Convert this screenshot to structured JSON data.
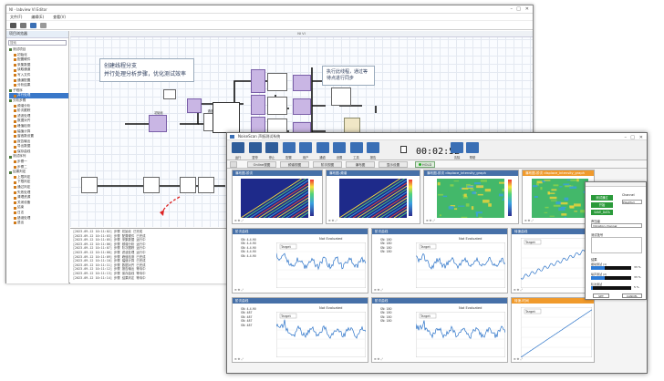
{
  "back_window": {
    "title": "NI - labview VI Editor",
    "menu": [
      "文件(F)",
      "编辑(E)",
      "查看(V)"
    ],
    "left_panel": {
      "header": "项目浏览器",
      "search_placeholder": "搜索",
      "tree": [
        {
          "label": "测试项目",
          "level": 0,
          "icon": "folder"
        },
        {
          "label": "初始化",
          "level": 1,
          "icon": "vi"
        },
        {
          "label": "配置硬件",
          "level": 1,
          "icon": "vi"
        },
        {
          "label": "采集数据",
          "level": 1,
          "icon": "vi"
        },
        {
          "label": "读取通道",
          "level": 1,
          "icon": "vi"
        },
        {
          "label": "写入文件",
          "level": 1,
          "icon": "vi"
        },
        {
          "label": "通道配置",
          "level": 1,
          "icon": "vi"
        },
        {
          "label": "分析结果",
          "level": 1,
          "icon": "vi"
        },
        {
          "label": "子程序",
          "level": 0,
          "icon": "folder"
        },
        {
          "label": "并行处理",
          "level": 1,
          "icon": "vi",
          "selected": true
        },
        {
          "label": "分析步骤",
          "level": 0,
          "icon": "folder"
        },
        {
          "label": "频谱分析",
          "level": 1,
          "icon": "vi"
        },
        {
          "label": "阶次跟踪",
          "level": 1,
          "icon": "vi"
        },
        {
          "label": "滤波处理",
          "level": 1,
          "icon": "vi"
        },
        {
          "label": "数据对齐",
          "level": 1,
          "icon": "vi"
        },
        {
          "label": "峰值检测",
          "level": 1,
          "icon": "vi"
        },
        {
          "label": "幅值计算",
          "level": 1,
          "icon": "vi"
        },
        {
          "label": "窗函数设置",
          "level": 1,
          "icon": "vi"
        },
        {
          "label": "报告输出",
          "level": 1,
          "icon": "vi"
        },
        {
          "label": "导出数据",
          "level": 1,
          "icon": "vi"
        },
        {
          "label": "保存曲线",
          "level": 1,
          "icon": "vi"
        },
        {
          "label": "测试序列",
          "level": 0,
          "icon": "folder"
        },
        {
          "label": "步骤一",
          "level": 1,
          "icon": "vi"
        },
        {
          "label": "步骤二",
          "level": 1,
          "icon": "vi"
        },
        {
          "label": "结果判定",
          "level": 0,
          "icon": "folder"
        },
        {
          "label": "上限判定",
          "level": 1,
          "icon": "vi"
        },
        {
          "label": "下限判定",
          "level": 1,
          "icon": "vi"
        },
        {
          "label": "通过判定",
          "level": 1,
          "icon": "vi"
        },
        {
          "label": "失败处理",
          "level": 1,
          "icon": "vi"
        },
        {
          "label": "清理资源",
          "level": 1,
          "icon": "vi"
        },
        {
          "label": "关闭设备",
          "level": 1,
          "icon": "vi"
        },
        {
          "label": "结束",
          "level": 1,
          "icon": "vi"
        },
        {
          "label": "日志",
          "level": 1,
          "icon": "vi"
        },
        {
          "label": "错误处理",
          "level": 1,
          "icon": "vi"
        },
        {
          "label": "退出",
          "level": 1,
          "icon": "vi"
        }
      ]
    },
    "canvas_tab": "NI VI",
    "note_left": [
      "创建线程分支",
      "并行处理分析步骤，优化测试效率"
    ],
    "note_right": [
      "执行此线程，通过等",
      "待点进行同步"
    ],
    "log_lines": [
      "[2023-09-12 10:11:02] 步骤 初始化 已完成",
      "[2023-09-12 10:11:03] 步骤 配置硬件 已完成",
      "[2023-09-12 10:11:05] 步骤 采集数据 运行中",
      "[2023-09-12 10:11:06] 步骤 频谱分析 运行中",
      "[2023-09-12 10:11:07] 步骤 阶次跟踪 运行中",
      "[2023-09-12 10:11:08] 步骤 滤波处理 运行中",
      "[2023-09-12 10:11:09] 步骤 峰值检测 已完成",
      "[2023-09-12 10:11:10] 步骤 幅值计算 已完成",
      "[2023-09-12 10:11:11] 步骤 数据对齐 已完成",
      "[2023-09-12 10:11:12] 步骤 报告输出 等待中",
      "[2023-09-12 10:11:13] 步骤 保存曲线 等待中",
      "[2023-09-12 10:11:14] 步骤 结果判定 等待中"
    ]
  },
  "front_window": {
    "title": "NoiseScan 声振测试系统",
    "toolbar": [
      "运行",
      "暂停",
      "停止",
      "配置",
      "用户",
      "通道",
      "设置",
      "工具",
      "报告",
      "清除",
      "帮助"
    ],
    "timer": "00:02:52",
    "tabs": [
      "Online视图",
      "频谱视图",
      "阶次视图",
      "瀑布图",
      "显示设置"
    ],
    "status": "HOLD",
    "panels": {
      "row1": [
        {
          "title": "瀑布图-阶次",
          "ylabel": "Speed (RPM)",
          "xlabel": "Frequency (Hz)"
        },
        {
          "title": "瀑布图-频谱",
          "ylabel": "Speed (RPM)",
          "xlabel": "Frequency (Hz)"
        },
        {
          "title": "瀑布图-阶次 displace_intensity_graph",
          "ylabel": "Speed (RPM)",
          "xlabel": ""
        },
        {
          "title": "瀑布图-阶次 displace_intensity_graph",
          "ylabel": "",
          "xlabel": ""
        }
      ],
      "row2": [
        {
          "title": "阶次曲线",
          "legend": [
            "SN: 4-4.90",
            "SN: 4-4.90",
            "SN: 4-4.90",
            "SN: 4-4.90",
            "SN: 4-4.90"
          ],
          "status": "Not Evaluated",
          "xlabel": "Frequency (Hz)",
          "ylabel": "Amplitude (dB ref 20 µPa)"
        },
        {
          "title": "阶次曲线",
          "legend": [
            "SN: 180",
            "SN: 180",
            "SN: 180",
            "SN: 180"
          ],
          "status": "Not Evaluated",
          "xlabel": "Frequency (Hz)",
          "ylabel": "Amplitude (dB ref 20 µPa)"
        },
        {
          "title": "转速曲线",
          "legend": [],
          "status": "",
          "xlabel": "Frequency (Hz)",
          "ylabel": "Speed"
        }
      ],
      "row3": [
        {
          "title": "阶次曲线",
          "legend": [
            "SN: 4-4.90",
            "SN: 487",
            "SN: 487",
            "SN: 487",
            "SN: 487"
          ],
          "status": "Not Evaluated",
          "xlabel": "Frequency (Hz)",
          "ylabel": "Amplitude (dB ref 20 µPa)"
        },
        {
          "title": "阶次曲线",
          "legend": [
            "SN: 180",
            "SN: 180",
            "SN: 180",
            "SN: 180"
          ],
          "status": "Not Evaluated",
          "xlabel": "Frequency (Hz)",
          "ylabel": "Amplitude (dB ref 20 µPa)"
        },
        {
          "title": "转速-时间",
          "legend": [],
          "status": "",
          "xlabel": "Time (s)",
          "ylabel": "Speed (RPM)"
        }
      ]
    },
    "badge": "Target",
    "dialog": {
      "buttons": [
        "测试通过",
        "开始",
        "SAVE_DATA"
      ],
      "labels": [
        "Channel",
        "PlayMod",
        "声压级",
        "测试批号",
        "结果"
      ],
      "field": "Vibration channel",
      "bars": [
        {
          "label": "振动测试 (1)",
          "pct_text": "33 %",
          "fill": 0.33
        },
        {
          "label": "噪声测试 (2)",
          "pct_text": "33 %",
          "fill": 0.33
        },
        {
          "label": "阶次测试",
          "pct_text": "5 %",
          "fill": 0.05
        }
      ],
      "bottom_buttons": [
        "SET",
        "CANCEL"
      ]
    }
  }
}
